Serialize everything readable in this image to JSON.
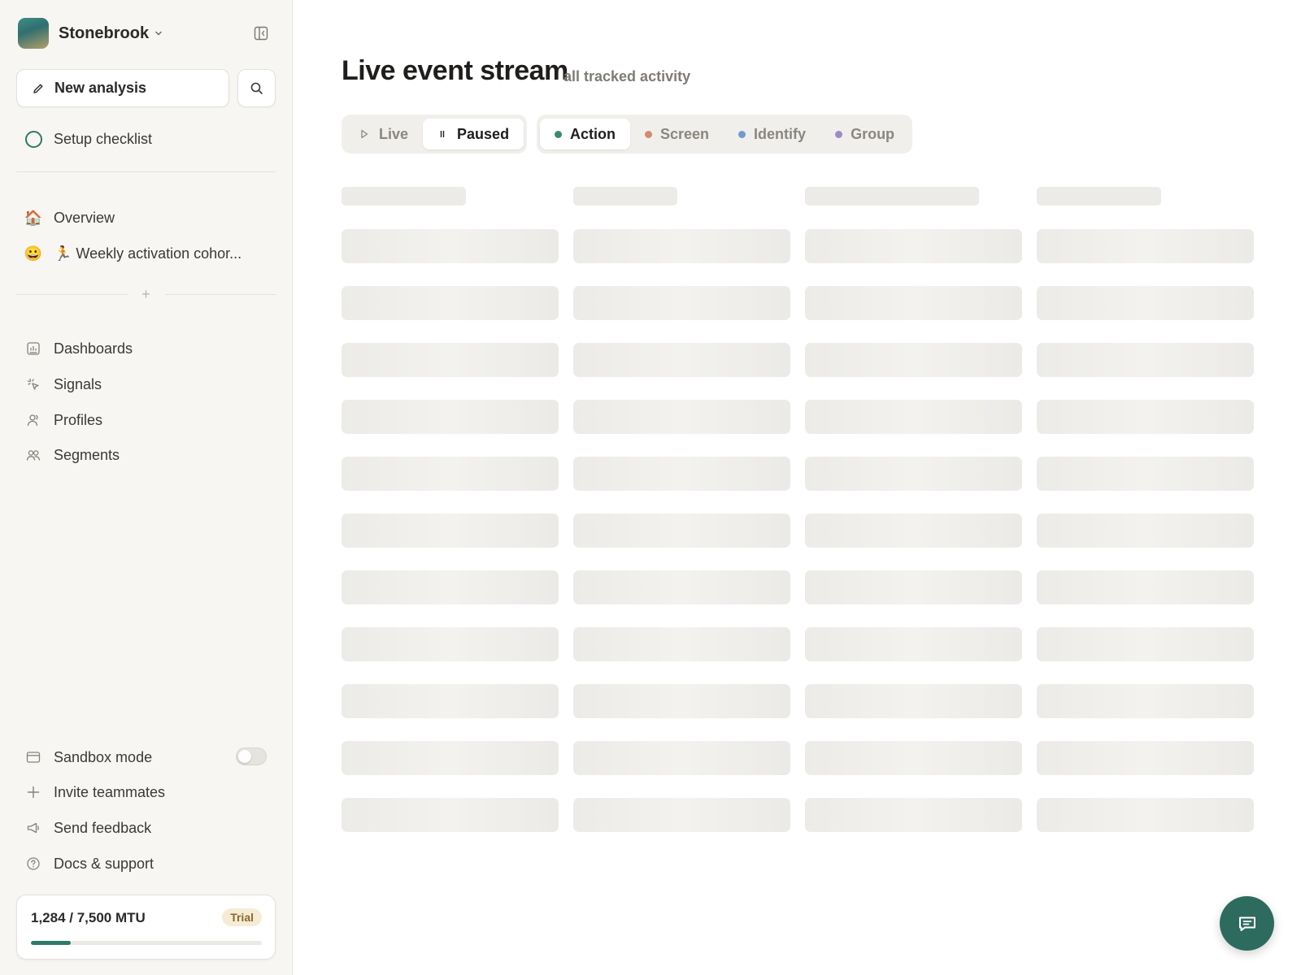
{
  "workspace": {
    "name": "Stonebrook"
  },
  "sidebar": {
    "new_analysis_label": "New analysis",
    "setup_checklist_label": "Setup checklist",
    "pinned": [
      {
        "icon": "house-emoji",
        "label": "Overview"
      },
      {
        "icon": "smiley-emoji",
        "label": "🏃 Weekly activation cohor..."
      }
    ],
    "nav": [
      {
        "icon": "dashboard-icon",
        "label": "Dashboards"
      },
      {
        "icon": "signals-icon",
        "label": "Signals"
      },
      {
        "icon": "profile-icon",
        "label": "Profiles"
      },
      {
        "icon": "segments-icon",
        "label": "Segments"
      }
    ],
    "footer": [
      {
        "icon": "sandbox-icon",
        "label": "Sandbox mode"
      },
      {
        "icon": "plus-icon",
        "label": "Invite teammates"
      },
      {
        "icon": "megaphone-icon",
        "label": "Send feedback"
      },
      {
        "icon": "help-icon",
        "label": "Docs & support"
      }
    ],
    "sandbox_enabled": false
  },
  "usage": {
    "count_label": "1,284 / 7,500 MTU",
    "badge": "Trial",
    "fraction": 0.171
  },
  "main": {
    "title": "Live event stream",
    "subtitle": "all tracked activity",
    "mode_tabs": [
      {
        "label": "Live",
        "icon": "play-icon",
        "active": false
      },
      {
        "label": "Paused",
        "icon": "pause-icon",
        "active": true
      }
    ],
    "type_filters": [
      {
        "label": "Action",
        "color": "#3a8a6e",
        "active": true
      },
      {
        "label": "Screen",
        "color": "#d28b6c",
        "active": false
      },
      {
        "label": "Identify",
        "color": "#6f9bd1",
        "active": false
      },
      {
        "label": "Group",
        "color": "#9d8bc9",
        "active": false
      }
    ],
    "loading": true
  },
  "colors": {
    "accent": "#2e7a68",
    "chat": "#2e6b5f"
  }
}
